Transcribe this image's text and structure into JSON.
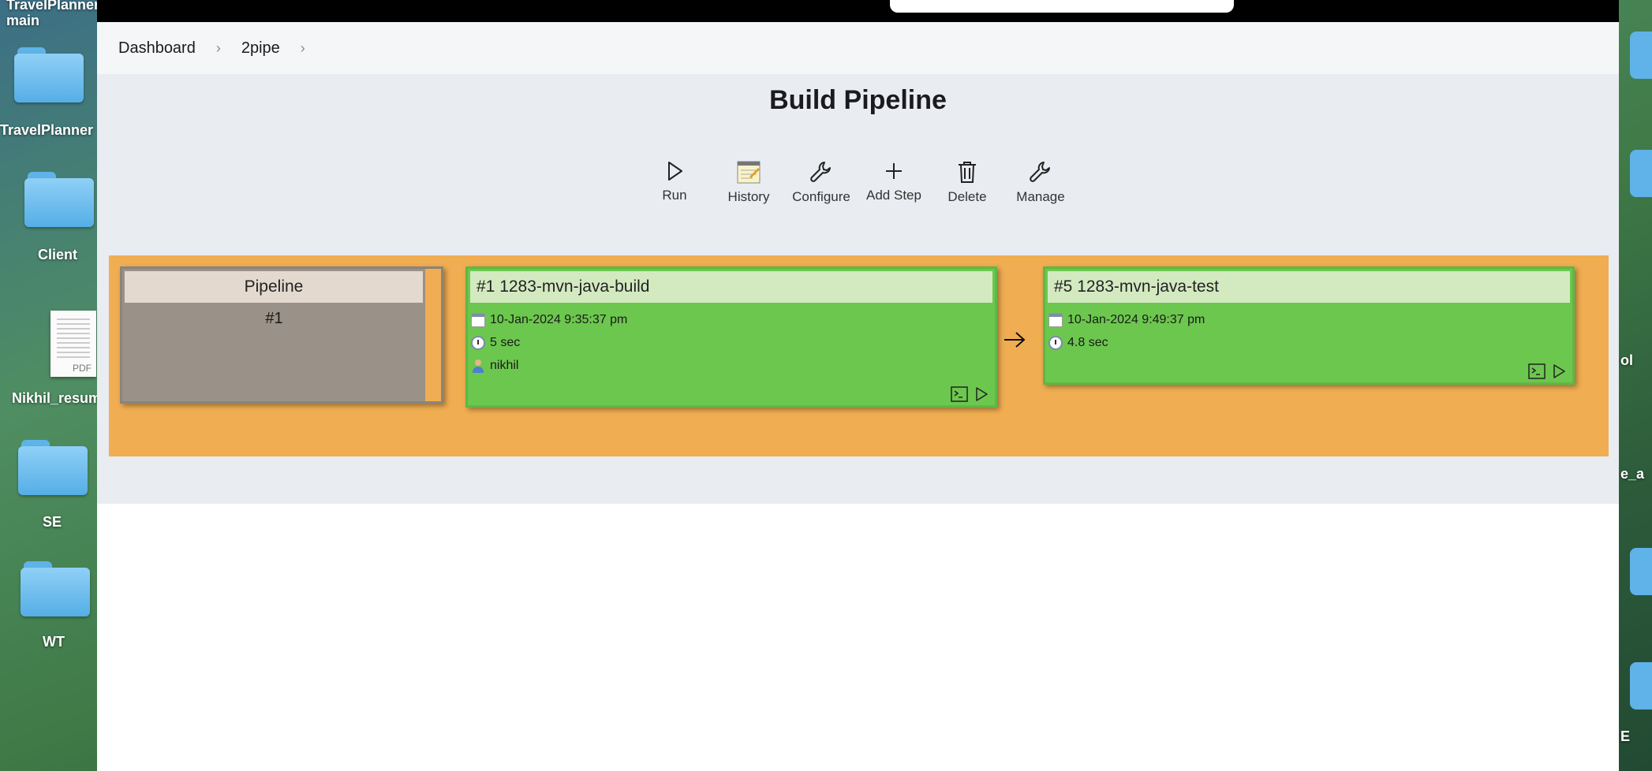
{
  "desktop": {
    "icons": [
      {
        "label": "TravelPlanner\nmain"
      },
      {
        "label": "TravelPlanner"
      },
      {
        "label": "Client"
      },
      {
        "label": "Nikhil_resum",
        "badge": "PDF"
      },
      {
        "label": "SE"
      },
      {
        "label": "WT"
      }
    ],
    "right_labels": [
      "ol",
      "e_a",
      "E"
    ]
  },
  "breadcrumb": {
    "items": [
      "Dashboard",
      "2pipe"
    ]
  },
  "page": {
    "title": "Build Pipeline"
  },
  "toolbar": {
    "run": "Run",
    "history": "History",
    "configure": "Configure",
    "add_step": "Add Step",
    "delete": "Delete",
    "manage": "Manage"
  },
  "pipeline": {
    "header": "Pipeline",
    "number": "#1",
    "builds": [
      {
        "title": "#1 1283-mvn-java-build",
        "date": "10-Jan-2024 9:35:37 pm",
        "duration": "5 sec",
        "user": "nikhil"
      },
      {
        "title": "#5 1283-mvn-java-test",
        "date": "10-Jan-2024 9:49:37 pm",
        "duration": "4.8 sec"
      }
    ]
  },
  "colors": {
    "pipeline_bg": "#f0ad52",
    "success": "#6cc74e",
    "success_header": "#d3eac1",
    "pipeline_card": "#9a9188"
  }
}
